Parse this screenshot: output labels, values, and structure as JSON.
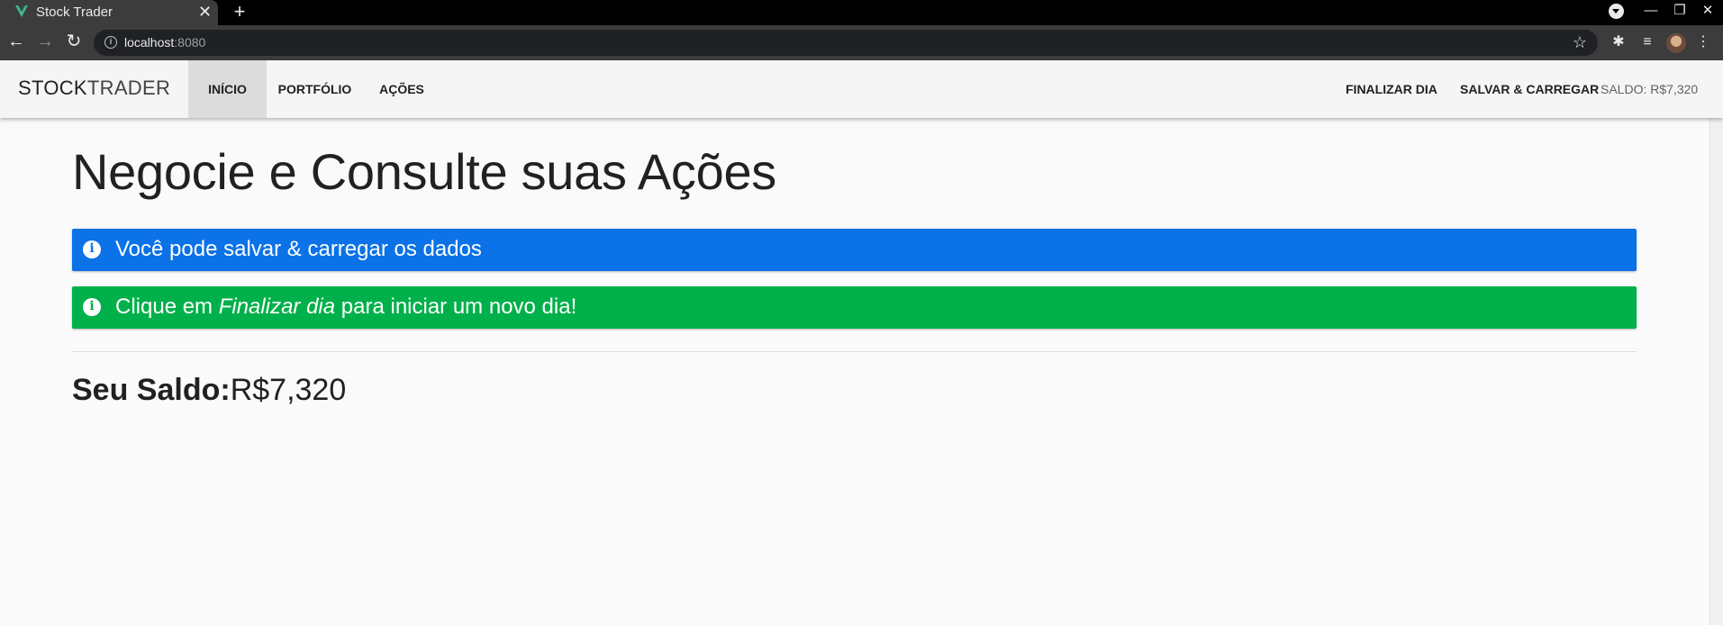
{
  "browser": {
    "tab_title": "Stock Trader",
    "close_glyph": "✕",
    "new_tab_glyph": "+",
    "url_host": "localhost",
    "url_port": ":8080",
    "back_glyph": "←",
    "forward_glyph": "→",
    "reload_glyph": "↻",
    "star_glyph": "☆",
    "extensions_glyph": "✱",
    "media_glyph": "≡",
    "menu_glyph": "⋮",
    "minimize_glyph": "—",
    "restore_glyph": "❐",
    "window_close_glyph": "✕",
    "favicon_color": "#41b883"
  },
  "navbar": {
    "brand_bold": "STOCK",
    "brand_light": "TRADER",
    "links": [
      "INÍCIO",
      "PORTFÓLIO",
      "AÇÕES"
    ],
    "active_link": "INÍCIO",
    "end_day": "FINALIZAR DIA",
    "save_load": "SALVAR & CARREGAR",
    "balance": "SALDO: R$7,320"
  },
  "main": {
    "headline": "Negocie e Consulte suas Ações",
    "alerts": {
      "info_text": "Você pode salvar & carregar os dados",
      "success_prefix": "Clique em ",
      "success_emph": "Finalizar dia",
      "success_suffix": " para iniciar um novo dia!",
      "icon_glyph": "i"
    },
    "balance_label": "Seu Saldo:",
    "balance_value": "R$7,320"
  },
  "colors": {
    "info": "#0b72e7",
    "success": "#00b04a",
    "nav_background": "#f5f5f5",
    "nav_active": "#dcdcdc"
  }
}
